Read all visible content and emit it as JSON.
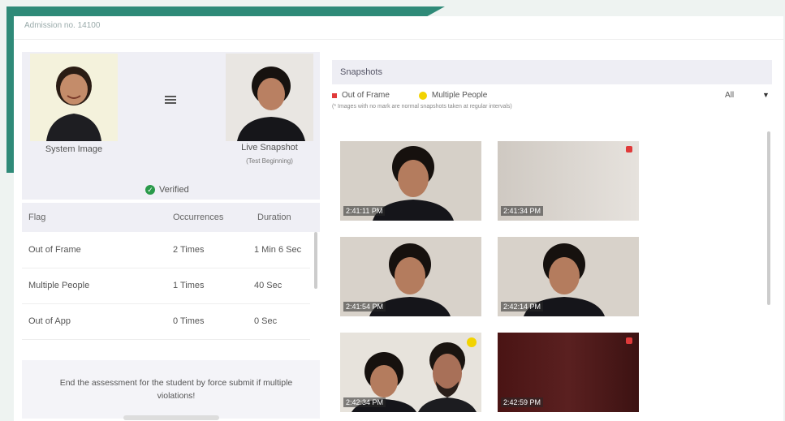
{
  "header": {
    "admission": "Admission no. 14100"
  },
  "verification": {
    "system_label": "System Image",
    "live_label": "Live Snapshot",
    "live_sub": "(Test Beginning)",
    "status": "Verified"
  },
  "flags_table": {
    "columns": [
      "Flag",
      "Occurrences",
      "Duration"
    ],
    "rows": [
      {
        "flag": "Out of Frame",
        "occurrences": "2 Times",
        "duration": "1 Min 6 Sec"
      },
      {
        "flag": "Multiple People",
        "occurrences": "1 Times",
        "duration": "40 Sec"
      },
      {
        "flag": "Out of App",
        "occurrences": "0 Times",
        "duration": "0 Sec"
      }
    ]
  },
  "force_submit": {
    "text": "End the assessment for the student by force submit if multiple violations!"
  },
  "snapshots": {
    "title": "Snapshots",
    "legend_out_of_frame": "Out of Frame",
    "legend_multiple": "Multiple People",
    "note": "(* Images with no mark are normal snapshots taken at regular intervals)",
    "filter": "All",
    "items": [
      {
        "time": "2:41:11 PM",
        "flag": "none"
      },
      {
        "time": "2:41:34 PM",
        "flag": "out-of-frame"
      },
      {
        "time": "2:41:54 PM",
        "flag": "none"
      },
      {
        "time": "2:42:14 PM",
        "flag": "none"
      },
      {
        "time": "2:42:34 PM",
        "flag": "multiple-people"
      },
      {
        "time": "2:42:59 PM",
        "flag": "out-of-frame"
      }
    ]
  },
  "colors": {
    "accent": "#2f8a78",
    "out_of_frame": "#e03a3a",
    "multiple_people": "#f2d300",
    "verified": "#2a9a4a"
  }
}
